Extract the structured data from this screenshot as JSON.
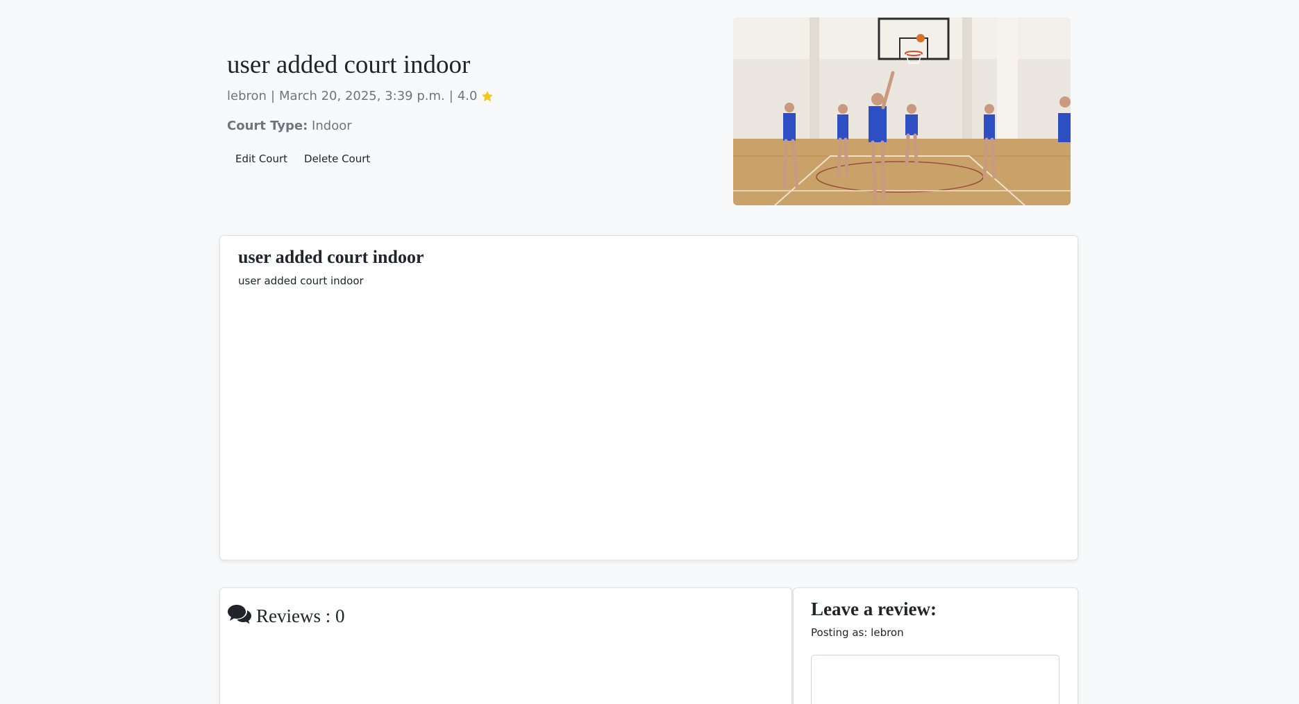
{
  "court": {
    "title": "user added court indoor",
    "author": "lebron",
    "date": "March 20, 2025, 3:39 p.m.",
    "separator": "|",
    "rating": "4.0",
    "type_label": "Court Type:",
    "type_value": "Indoor"
  },
  "actions": {
    "edit_label": "Edit Court",
    "delete_label": "Delete Court"
  },
  "description": {
    "title": "user added court indoor",
    "text": "user added court indoor"
  },
  "reviews": {
    "heading": "Reviews : 0"
  },
  "leave_review": {
    "title": "Leave a review:",
    "posting_as": "Posting as: lebron",
    "textarea_value": ""
  },
  "icons": {
    "rating": "star-icon",
    "reviews": "comments-icon"
  },
  "colors": {
    "star": "#f5c518",
    "muted_text": "#6c757d",
    "jersey": "#2e4fc4"
  }
}
